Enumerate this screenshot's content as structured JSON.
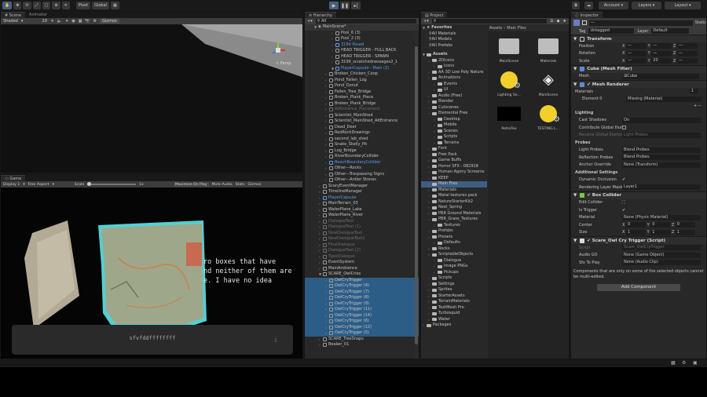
{
  "toolbar": {
    "pivot": "Pivot",
    "global": "Global",
    "account": "Account",
    "layers": "Layers",
    "layout": "Layout"
  },
  "scene": {
    "tab": "Scene",
    "tab2": "Animator",
    "shading": "Shaded",
    "mode": "2D",
    "gizmos": "Gizmos",
    "persp": "< Persp"
  },
  "game": {
    "tab": "Game",
    "display": "Display 1",
    "aspect": "Free Aspect",
    "scale_label": "Scale",
    "scale_val": "1x",
    "maximize": "Maximize On Play",
    "mute": "Mute Audio",
    "stats": "Stats",
    "gizmos": "Gizmos",
    "dialog": [
      "ro boxes that have",
      "nd neither of them are",
      "e. I have no idea"
    ],
    "input": "sfvfddffffffff"
  },
  "hierarchy": {
    "tab": "Hierarchy",
    "search": "All",
    "scene_name": "MainScene*",
    "items": [
      {
        "d": 1,
        "t": "Pool_6 (3)",
        "c": ""
      },
      {
        "d": 1,
        "t": "Pool_2 (3)",
        "c": ""
      },
      {
        "d": 1,
        "t": "3199 Posed",
        "c": "blue"
      },
      {
        "d": 1,
        "t": "HEAD TRIGGER - FULL BACK",
        "c": ""
      },
      {
        "d": 1,
        "t": "HEAD TRIGGER - SPAWN",
        "c": ""
      },
      {
        "d": 1,
        "t": "3199_scratchednessages2_1",
        "c": ""
      },
      {
        "d": 1,
        "t": "PlayerCapsule - Main (2)",
        "c": "blue",
        "a": "v"
      },
      {
        "d": 0,
        "t": "Broken_Chicken_Coop",
        "c": ""
      },
      {
        "d": 0,
        "t": "Pond_Fallen_Log",
        "c": ""
      },
      {
        "d": 0,
        "t": "Pond_Donut",
        "c": ""
      },
      {
        "d": 0,
        "t": "Fallen_Tree_Bridge",
        "c": ""
      },
      {
        "d": 0,
        "t": "Broken_Plank_Piece",
        "c": ""
      },
      {
        "d": 0,
        "t": "Broken_Plank_Bridge",
        "c": ""
      },
      {
        "d": 0,
        "t": "AllEntrance_Placement",
        "c": "gray"
      },
      {
        "d": 0,
        "t": "Scientist_MainShed",
        "c": ""
      },
      {
        "d": 0,
        "t": "Scientist_MainShed_AltEntrance",
        "c": ""
      },
      {
        "d": 0,
        "t": "Dead_Deer",
        "c": ""
      },
      {
        "d": 0,
        "t": "RedRockDrawings",
        "c": ""
      },
      {
        "d": 0,
        "t": "second_lab_shed",
        "c": ""
      },
      {
        "d": 0,
        "t": "Snake_Skelly_Pit",
        "c": ""
      },
      {
        "d": 0,
        "t": "Log_Bridge",
        "c": ""
      },
      {
        "d": 0,
        "t": "RiverBoundaryCollider",
        "c": ""
      },
      {
        "d": 0,
        "t": "BeachBoundaryCollider",
        "c": "blue"
      },
      {
        "d": 0,
        "t": "Other---Rocks",
        "c": ""
      },
      {
        "d": 0,
        "t": "Other---Trespassing Signs",
        "c": ""
      },
      {
        "d": 0,
        "t": "Other---Antler Stones",
        "c": ""
      },
      {
        "d": -1,
        "t": "ScaryEventManager",
        "c": ""
      },
      {
        "d": -1,
        "t": "TimelineManager",
        "c": ""
      },
      {
        "d": -1,
        "t": "PlayerCapsule",
        "c": "blue"
      },
      {
        "d": -1,
        "t": "MainTerrain_03",
        "c": ""
      },
      {
        "d": -1,
        "t": "WaterPlane_Lake",
        "c": ""
      },
      {
        "d": -1,
        "t": "WaterPlane_River",
        "c": ""
      },
      {
        "d": -1,
        "t": "DialogueText",
        "c": "gray"
      },
      {
        "d": -1,
        "t": "DialogueText (1)",
        "c": "gray"
      },
      {
        "d": -1,
        "t": "NewDialogueText",
        "c": "gray"
      },
      {
        "d": -1,
        "t": "NewDialogueText2",
        "c": "gray"
      },
      {
        "d": -1,
        "t": "FinalDialogue",
        "c": "gray"
      },
      {
        "d": -1,
        "t": "DialogueText (2)",
        "c": "gray"
      },
      {
        "d": -1,
        "t": "TypeDialogue",
        "c": "gray"
      },
      {
        "d": -1,
        "t": "EventSystem",
        "c": ""
      },
      {
        "d": -1,
        "t": "MainAmbience",
        "c": ""
      },
      {
        "d": -1,
        "t": "SCARE_OwlCries",
        "c": "",
        "a": "v"
      },
      {
        "d": 0,
        "t": "OwlCryTrigger",
        "c": "",
        "s": 1
      },
      {
        "d": 0,
        "t": "OwlCryTrigger (4)",
        "c": "",
        "s": 1
      },
      {
        "d": 0,
        "t": "OwlCryTrigger (7)",
        "c": "",
        "s": 1
      },
      {
        "d": 0,
        "t": "OwlCryTrigger (8)",
        "c": "",
        "s": 1
      },
      {
        "d": 0,
        "t": "OwlCryTrigger (9)",
        "c": "",
        "s": 1
      },
      {
        "d": 0,
        "t": "OwlCryTrigger (11)",
        "c": "",
        "s": 1
      },
      {
        "d": 0,
        "t": "OwlCryTrigger (14)",
        "c": "",
        "s": 1
      },
      {
        "d": 0,
        "t": "OwlCryTrigger (6)",
        "c": "",
        "s": 1
      },
      {
        "d": 0,
        "t": "OwlCryTrigger (12)",
        "c": "",
        "s": 1
      },
      {
        "d": 0,
        "t": "OwlCryTrigger (5)",
        "c": "",
        "s": 1
      },
      {
        "d": -1,
        "t": "SCARE_TreeSnaps",
        "c": ""
      },
      {
        "d": -1,
        "t": "Beaker_01",
        "c": ""
      }
    ]
  },
  "project": {
    "tab": "Project",
    "favorites": "Favorites",
    "fav_items": [
      "All Materials",
      "All Models",
      "All Prefabs"
    ],
    "assets": "Assets",
    "tree": [
      {
        "d": 1,
        "t": "2DIcons"
      },
      {
        "d": 2,
        "t": "Icons"
      },
      {
        "d": 1,
        "t": "AA 3D Low Poly Nature"
      },
      {
        "d": 1,
        "t": "Animations"
      },
      {
        "d": 2,
        "t": "Events"
      },
      {
        "d": 2,
        "t": "UI"
      },
      {
        "d": 1,
        "t": "Audio (Free)"
      },
      {
        "d": 1,
        "t": "Blender"
      },
      {
        "d": 1,
        "t": "Cutscenes"
      },
      {
        "d": 1,
        "t": "Elemental Free"
      },
      {
        "d": 2,
        "t": "Desktop"
      },
      {
        "d": 2,
        "t": "Mobile"
      },
      {
        "d": 2,
        "t": "Scenes"
      },
      {
        "d": 2,
        "t": "Scripts"
      },
      {
        "d": 2,
        "t": "Terrains"
      },
      {
        "d": 1,
        "t": "Font"
      },
      {
        "d": 1,
        "t": "Free Pack"
      },
      {
        "d": 1,
        "t": "Game Buffs"
      },
      {
        "d": 1,
        "t": "Horror SFX - 082918"
      },
      {
        "d": 1,
        "t": "Human Agony Screams"
      },
      {
        "d": 1,
        "t": "KEEP"
      },
      {
        "d": 1,
        "t": "Main Files",
        "sel": 1
      },
      {
        "d": 1,
        "t": "Materials"
      },
      {
        "d": 1,
        "t": "Metal textures pack"
      },
      {
        "d": 1,
        "t": "NatureStarterKit2"
      },
      {
        "d": 1,
        "t": "Nest_Spring"
      },
      {
        "d": 1,
        "t": "PBR Ground Materials"
      },
      {
        "d": 1,
        "t": "PBR_Grass_Textures"
      },
      {
        "d": 2,
        "t": "Textures"
      },
      {
        "d": 1,
        "t": "Prefabs"
      },
      {
        "d": 1,
        "t": "Presets"
      },
      {
        "d": 2,
        "t": "Defaults"
      },
      {
        "d": 1,
        "t": "Rocks"
      },
      {
        "d": 1,
        "t": "ScriptableObjects"
      },
      {
        "d": 2,
        "t": "Dialogue"
      },
      {
        "d": 2,
        "t": "Image PNGs"
      },
      {
        "d": 2,
        "t": "Pickups"
      },
      {
        "d": 1,
        "t": "Scripts"
      },
      {
        "d": 1,
        "t": "Settings"
      },
      {
        "d": 1,
        "t": "Sprites"
      },
      {
        "d": 1,
        "t": "StarterAssets"
      },
      {
        "d": 1,
        "t": "TerrainMaterials"
      },
      {
        "d": 1,
        "t": "TextMesh Pro"
      },
      {
        "d": 1,
        "t": "Turbosquid"
      },
      {
        "d": 1,
        "t": "Water"
      },
      {
        "d": 0,
        "t": "Packages"
      }
    ],
    "breadcrumb": [
      "Assets",
      "Main Files"
    ],
    "files": [
      {
        "t": "MainScene",
        "k": "folder"
      },
      {
        "t": "Materials",
        "k": "folder"
      },
      {
        "t": "Lighting Se...",
        "k": "light"
      },
      {
        "t": "MainScene",
        "k": "unity"
      },
      {
        "t": "RetroTex",
        "k": "black"
      },
      {
        "t": "TESTING L...",
        "k": "light"
      }
    ]
  },
  "inspector": {
    "tab": "Inspector",
    "static": "Static",
    "tag_label": "Tag",
    "tag": "Untagged",
    "layer_label": "Layer",
    "layer": "Default",
    "transform": "Transform",
    "pos": "Position",
    "rot": "Rotation",
    "scale": "Scale",
    "zval": "20",
    "meshfilter": "Cube (Mesh Filter)",
    "mesh_label": "Mesh",
    "mesh": "Cube",
    "meshrenderer": "Mesh Renderer",
    "materials": "Materials",
    "materials_count": "1",
    "element0": "Element 0",
    "element0_val": "Missing (Material)",
    "lighting": "Lighting",
    "cast": "Cast Shadows",
    "cast_val": "On",
    "contrib": "Contribute Global Illumination",
    "receive": "Receive Global Illumination",
    "receive_val": "Light Probes",
    "probes": "Probes",
    "lightprobes": "Light Probes",
    "lightprobes_val": "Blend Probes",
    "refl": "Reflection Probes",
    "refl_val": "Blend Probes",
    "anchor": "Anchor Override",
    "anchor_val": "None (Transform)",
    "additional": "Additional Settings",
    "dyn": "Dynamic Occlusion",
    "renderlayer": "Rendering Layer Mask",
    "renderlayer_val": "Layer1",
    "boxcollider": "Box Collider",
    "editcollider": "Edit Collider",
    "istrigger": "Is Trigger",
    "material": "Material",
    "material_val": "None (Physic Material)",
    "center": "Center",
    "size": "Size",
    "center_vals": [
      "0",
      "0",
      "0"
    ],
    "size_vals": [
      "1",
      "1",
      "1"
    ],
    "script_comp": "Scare_Owl Cry Trigger (Script)",
    "script": "Script",
    "script_val": "Scare_OwlCryTrigger",
    "audiogo": "Audio GO",
    "audiogo_val": "None (Game Object)",
    "sfx": "Sfx To Play",
    "sfx_val": "None (Audio Clip)",
    "note": "Components that are only on some of the selected objects cannot be multi-edited.",
    "add": "Add Component"
  }
}
